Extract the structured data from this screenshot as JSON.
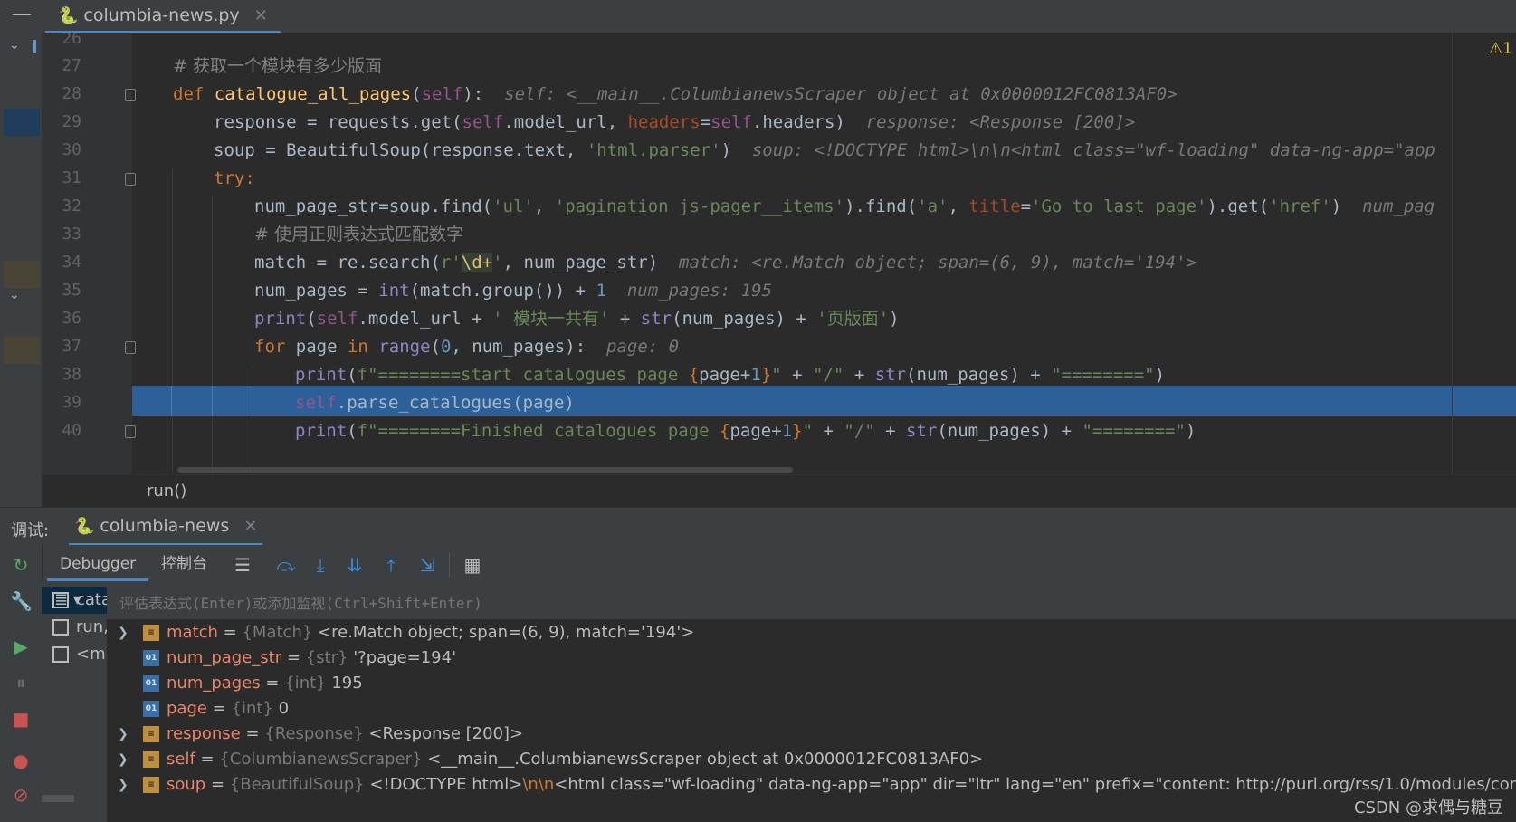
{
  "editor_tab": {
    "filename": "columbia-news.py"
  },
  "warnings": {
    "count": "1"
  },
  "code_lines": [
    {
      "n": "26"
    },
    {
      "n": "27",
      "comment": "# 获取一个模块有多少版面"
    },
    {
      "n": "28",
      "kw": "def",
      "fn": "catalogue_all_pages",
      "self": "self",
      "rest": "):",
      "hint": "self: <__main__.ColumbianewsScraper object at 0x0000012FC0813AF0>"
    },
    {
      "n": "29",
      "hint": "response: <Response [200]>"
    },
    {
      "n": "30",
      "hint": "soup: <!DOCTYPE html>\\n\\n<html class=\"wf-loading\" data-ng-app=\"app"
    },
    {
      "n": "31",
      "kw": "try:"
    },
    {
      "n": "32",
      "hint": "num_pag"
    },
    {
      "n": "33",
      "comment": "# 使用正则表达式匹配数字"
    },
    {
      "n": "34",
      "hint": "match: <re.Match object; span=(6, 9), match='194'>"
    },
    {
      "n": "35",
      "hint": "num_pages: 195"
    },
    {
      "n": "36"
    },
    {
      "n": "37",
      "hint": "page: 0"
    },
    {
      "n": "38"
    },
    {
      "n": "39"
    },
    {
      "n": "40"
    }
  ],
  "breadcrumb": "run()",
  "debug": {
    "label": "调试:",
    "session_tab": "columbia-news",
    "tabs": {
      "debugger": "Debugger",
      "console": "控制台"
    },
    "eval_placeholder": "评估表达式(Enter)或添加监视(Ctrl+Shift+Enter)",
    "frames": [
      "cata",
      "run,",
      "<m"
    ],
    "variables": [
      {
        "name": "match",
        "type": "{Match}",
        "value": "<re.Match object; span=(6, 9), match='194'>",
        "expandable": true,
        "icon": "object"
      },
      {
        "name": "num_page_str",
        "type": "{str}",
        "value": "'?page=194'",
        "expandable": false,
        "icon": "primitive"
      },
      {
        "name": "num_pages",
        "type": "{int}",
        "value": "195",
        "expandable": false,
        "icon": "primitive"
      },
      {
        "name": "page",
        "type": "{int}",
        "value": "0",
        "expandable": false,
        "icon": "primitive"
      },
      {
        "name": "response",
        "type": "{Response}",
        "value": "<Response [200]>",
        "expandable": true,
        "icon": "object"
      },
      {
        "name": "self",
        "type": "{ColumbianewsScraper}",
        "value": "<__main__.ColumbianewsScraper object at 0x0000012FC0813AF0>",
        "expandable": true,
        "icon": "object"
      },
      {
        "name": "soup",
        "type": "{BeautifulSoup}",
        "value": "<!DOCTYPE html>",
        "value_esc": "\\n\\n",
        "value_tail": "<html class=\"wf-loading\" data-ng-app=\"app\" dir=\"ltr\" lang=\"en\" prefix=\"content: http://purl.org/rss/1.0/modules/content/",
        "expandable": true,
        "icon": "object"
      }
    ]
  },
  "watermark": "CSDN @求偶与糖豆",
  "colors": {
    "accent": "#4a88c7",
    "selection": "#2d6099",
    "editor_bg": "#2b2b2b",
    "panel_bg": "#3c3f41"
  }
}
